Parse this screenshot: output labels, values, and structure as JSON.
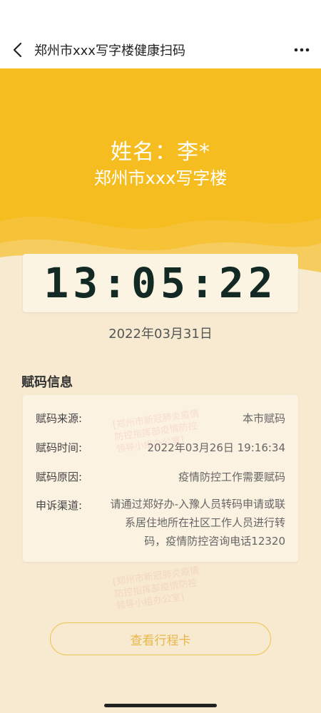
{
  "nav": {
    "title": "郑州市xxx写字楼健康扫码"
  },
  "hero": {
    "name": "姓名：李*",
    "place": "郑州市xxx写字楼"
  },
  "clock": {
    "time": "13:05:22",
    "date": "2022年03月31日"
  },
  "info": {
    "section_title": "赋码信息",
    "rows": [
      {
        "label": "赋码来源:",
        "value": "本市赋码"
      },
      {
        "label": "赋码时间:",
        "value": "2022年03月26日 19:16:34"
      },
      {
        "label": "赋码原因:",
        "value": "疫情防控工作需要赋码"
      },
      {
        "label": "申诉渠道:",
        "value": "请通过郑好办-入豫人员转码申请或联系居住地所在社区工作人员进行转码，疫情防控咨询电话12320"
      }
    ]
  },
  "watermark": {
    "line1": "[郑州市新冠肺炎疫情",
    "line2": "防控指挥部疫情防控",
    "line3": "领导小组办公室]"
  },
  "actions": {
    "trip_card_label": "查看行程卡"
  },
  "colors": {
    "hero_yellow": "#f5bd1f",
    "page_bg": "#f7ead1",
    "button_border": "#f0c34a"
  }
}
